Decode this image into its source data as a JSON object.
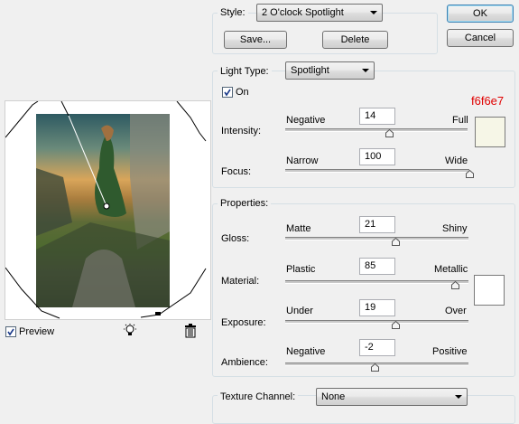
{
  "style_group": {
    "legend": "Style:",
    "selected": "2 O'clock Spotlight",
    "save_label": "Save...",
    "delete_label": "Delete"
  },
  "dialog_buttons": {
    "ok_label": "OK",
    "cancel_label": "Cancel"
  },
  "light_type": {
    "legend": "Light Type:",
    "selected": "Spotlight",
    "on_label": "On",
    "on_checked": true,
    "hex_color": "f6f6e7",
    "swatch_color": "#f6f6e7",
    "intensity": {
      "label": "Intensity:",
      "min_label": "Negative",
      "max_label": "Full",
      "value": "14",
      "fraction": 0.57
    },
    "focus": {
      "label": "Focus:",
      "min_label": "Narrow",
      "max_label": "Wide",
      "value": "100",
      "fraction": 1.0
    }
  },
  "properties": {
    "legend": "Properties:",
    "swatch_color": "#ffffff",
    "gloss": {
      "label": "Gloss:",
      "min_label": "Matte",
      "max_label": "Shiny",
      "value": "21",
      "fraction": 0.6
    },
    "material": {
      "label": "Material:",
      "min_label": "Plastic",
      "max_label": "Metallic",
      "value": "85",
      "fraction": 0.925
    },
    "exposure": {
      "label": "Exposure:",
      "min_label": "Under",
      "max_label": "Over",
      "value": "19",
      "fraction": 0.6
    },
    "ambience": {
      "label": "Ambience:",
      "min_label": "Negative",
      "max_label": "Positive",
      "value": "-2",
      "fraction": 0.49
    }
  },
  "texture": {
    "legend": "Texture Channel:",
    "selected": "None"
  },
  "preview": {
    "label": "Preview",
    "checked": true,
    "light_bulb_icon": "light-bulb-icon",
    "trash_icon": "trash-icon"
  }
}
